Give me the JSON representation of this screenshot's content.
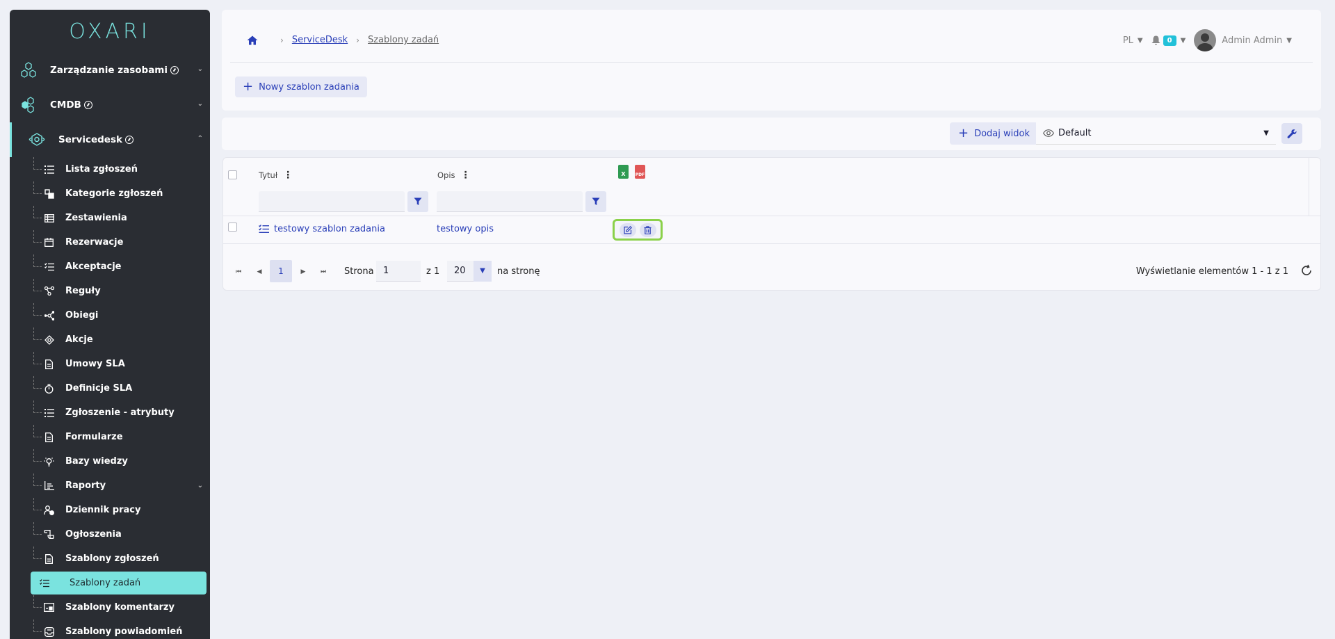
{
  "brand": {
    "logo": "OXARI"
  },
  "sidebar": {
    "top_items": [
      {
        "label": "Zarządzanie zasobami",
        "icon": "hexagons-icon"
      },
      {
        "label": "CMDB",
        "icon": "cubes-icon"
      },
      {
        "label": "Servicedesk",
        "icon": "servicedesk-icon"
      }
    ],
    "sub_items": [
      {
        "label": "Lista zgłoszeń",
        "icon": "list-icon"
      },
      {
        "label": "Kategorie zgłoszeń",
        "icon": "categories-icon"
      },
      {
        "label": "Zestawienia",
        "icon": "table-icon"
      },
      {
        "label": "Rezerwacje",
        "icon": "calendar-icon"
      },
      {
        "label": "Akceptacje",
        "icon": "checklist-icon"
      },
      {
        "label": "Reguły",
        "icon": "rules-icon"
      },
      {
        "label": "Obiegi",
        "icon": "workflow-icon"
      },
      {
        "label": "Akcje",
        "icon": "actions-icon"
      },
      {
        "label": "Umowy SLA",
        "icon": "document-icon"
      },
      {
        "label": "Definicje SLA",
        "icon": "stopwatch-icon"
      },
      {
        "label": "Zgłoszenie - atrybuty",
        "icon": "list-icon"
      },
      {
        "label": "Formularze",
        "icon": "form-icon"
      },
      {
        "label": "Bazy wiedzy",
        "icon": "lightbulb-icon"
      },
      {
        "label": "Raporty",
        "icon": "chart-icon"
      },
      {
        "label": "Dziennik pracy",
        "icon": "user-clock-icon"
      },
      {
        "label": "Ogłoszenia",
        "icon": "announcement-icon"
      },
      {
        "label": "Szablony zgłoszeń",
        "icon": "document-icon"
      },
      {
        "label": "Szablony zadań",
        "icon": "checklist-icon"
      },
      {
        "label": "Szablony komentarzy",
        "icon": "comment-template-icon"
      },
      {
        "label": "Szablony powiadomień",
        "icon": "inbox-icon"
      }
    ]
  },
  "breadcrumb": {
    "items": [
      "ServiceDesk",
      "Szablony zadań"
    ]
  },
  "header": {
    "language": "PL",
    "notifications": "0",
    "user": "Admin Admin"
  },
  "toolbar": {
    "new_button": "Nowy szablon zadania"
  },
  "viewbar": {
    "add_view": "Dodaj widok",
    "selected_view": "Default"
  },
  "grid": {
    "columns": [
      "Tytuł",
      "Opis"
    ],
    "export": {
      "xls": "X",
      "pdf": "PDF"
    },
    "rows": [
      {
        "title": "testowy szablon zadania",
        "description": "testowy opis"
      }
    ]
  },
  "pager": {
    "current_page": "1",
    "page_label": "Strona",
    "page_input": "1",
    "of_label": "z 1",
    "page_size": "20",
    "per_page_label": "na stronę",
    "info": "Wyświetlanie elementów 1 - 1 z 1"
  },
  "colors": {
    "accent": "#7ae3df",
    "link": "#2a3fb8",
    "sidebar_bg": "#2a2d33",
    "highlight": "#8bd14a",
    "badge": "#22c1d9"
  }
}
